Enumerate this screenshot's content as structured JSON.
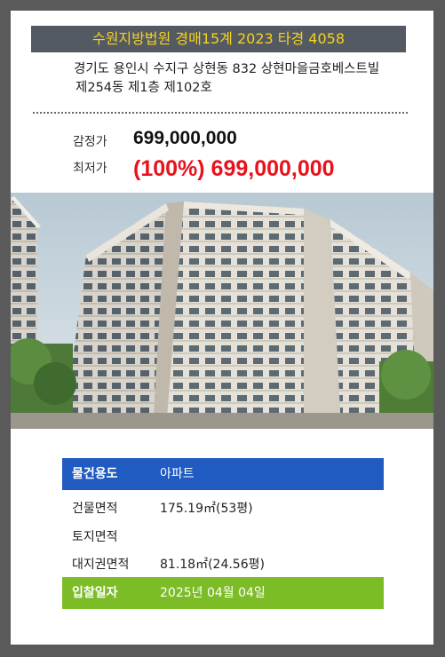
{
  "header": {
    "title": "수원지방법원 경매15계 2023 타경 4058"
  },
  "address": {
    "line1": "경기도 용인시 수지구 상현동 832 상현마을금호베스트빌",
    "line2": "제254동 제1층 제102호"
  },
  "prices": {
    "appraisal_label": "감정가",
    "appraisal_value": "699,000,000",
    "minimum_label": "최저가",
    "minimum_value": "(100%) 699,000,000"
  },
  "photo": {
    "subject": "apartment-building"
  },
  "details": [
    {
      "label": "물건용도",
      "value": "아파트"
    },
    {
      "label": "건물면적",
      "value": "175.19㎡(53평)"
    },
    {
      "label": "토지면적",
      "value": ""
    },
    {
      "label": "대지권면적",
      "value": "81.18㎡(24.56평)"
    },
    {
      "label": "입찰일자",
      "value": "2025년 04월 04일"
    }
  ],
  "colors": {
    "header_bg": "#545a61",
    "header_text": "#f6d21f",
    "min_price": "#e8121c",
    "usage_row": "#1f5bc0",
    "bid_row": "#7cbc26"
  }
}
